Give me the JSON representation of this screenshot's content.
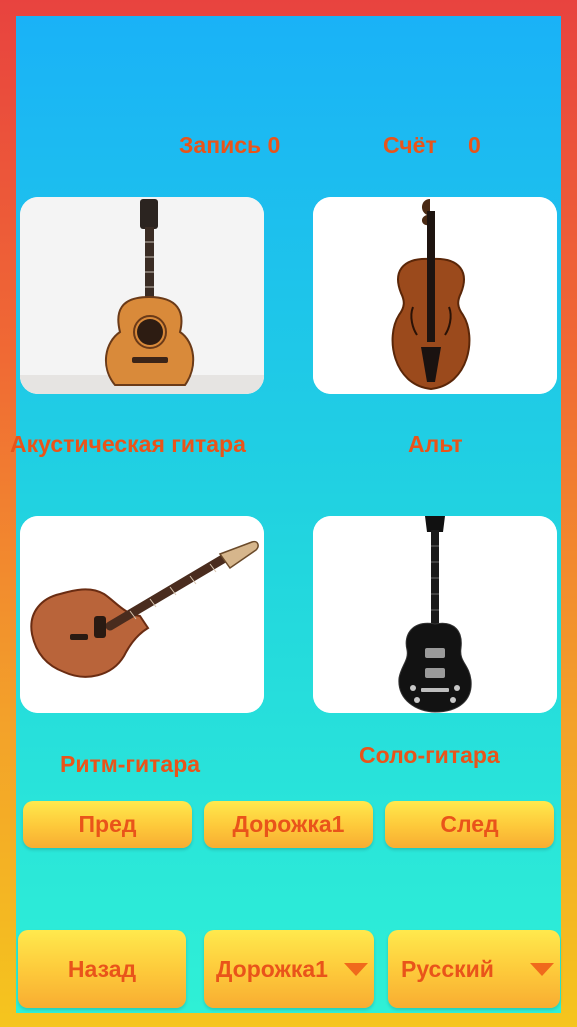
{
  "stats": {
    "record_label": "Запись 0",
    "score_label": "Счёт",
    "score_value": "0"
  },
  "instruments": [
    {
      "name": "Акустическая гитара",
      "icon": "acoustic-guitar-icon"
    },
    {
      "name": "Альт",
      "icon": "viola-icon"
    },
    {
      "name": "Ритм-гитара",
      "icon": "rhythm-guitar-icon"
    },
    {
      "name": "Соло-гитара",
      "icon": "solo-guitar-icon"
    }
  ],
  "controls": {
    "prev_label": "Пред",
    "track_label": "Дорожка1",
    "next_label": "След"
  },
  "bottom": {
    "back_label": "Назад",
    "track_select_value": "Дорожка1",
    "language_select_value": "Русский"
  },
  "colors": {
    "text_accent": "#e9541a",
    "button_top": "#ffe94d",
    "button_bottom": "#f8ad32",
    "background_top": "#1ab2f7",
    "background_bottom": "#2ff0d6",
    "border": "#e8433f"
  }
}
